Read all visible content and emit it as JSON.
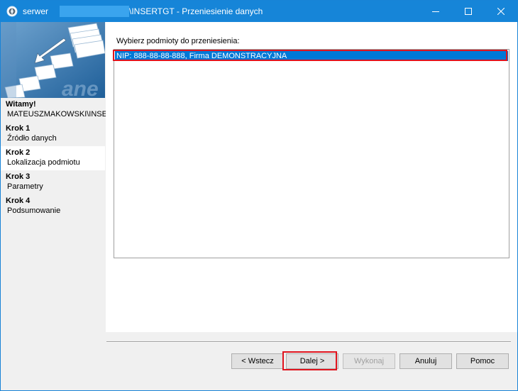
{
  "window": {
    "title_prefix": "serwer",
    "title_suffix": "\\INSERTGT - Przeniesienie danych",
    "accent_color": "#1685d8"
  },
  "sidebar": {
    "welcome": {
      "title": "Witamy!",
      "subtitle": "MATEUSZMAKOWSKI\\INSE"
    },
    "steps": [
      {
        "title": "Krok 1",
        "subtitle": "Źródło danych",
        "active": false
      },
      {
        "title": "Krok 2",
        "subtitle": "Lokalizacja podmiotu",
        "active": true
      },
      {
        "title": "Krok 3",
        "subtitle": "Parametry",
        "active": false
      },
      {
        "title": "Krok 4",
        "subtitle": "Podsumowanie",
        "active": false
      }
    ]
  },
  "content": {
    "list_label": "Wybierz podmioty do przeniesienia:",
    "list_items": [
      {
        "text": "NIP: 888-88-88-888, Firma DEMONSTRACYJNA",
        "selected": true
      }
    ]
  },
  "buttons": {
    "back": "< Wstecz",
    "next": "Dalej >",
    "run": "Wykonaj",
    "cancel": "Anuluj",
    "help": "Pomoc"
  },
  "icons": {
    "app": "app-globe-icon",
    "minimize": "minimize-icon",
    "maximize": "maximize-icon",
    "close": "close-icon"
  },
  "highlight_color": "#e0141e",
  "selection_color": "#0078d7"
}
